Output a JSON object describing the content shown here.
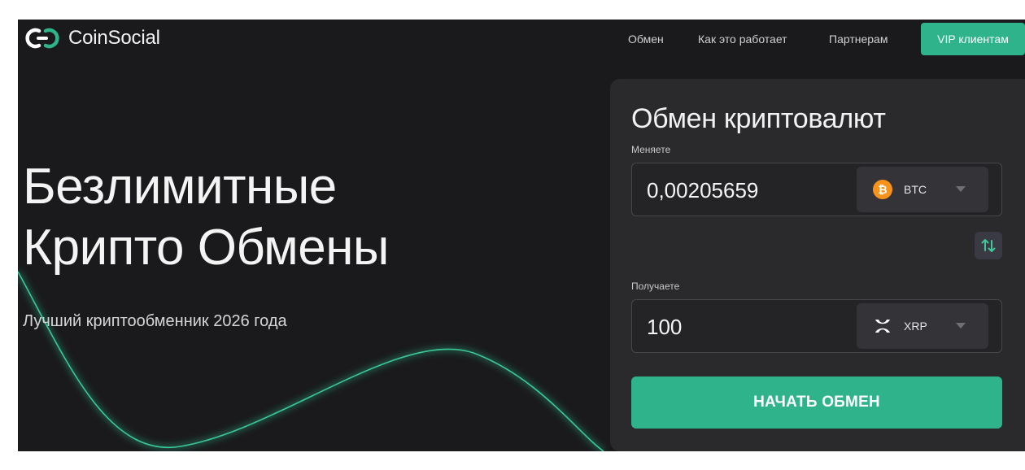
{
  "brand": {
    "name": "CoinSocial",
    "accent": "#2fb38a"
  },
  "nav": {
    "links": [
      "Обмен",
      "Как это работает",
      "Партнерам"
    ],
    "vip_label": "VIP клиентам"
  },
  "hero": {
    "title_line1": "Безлимитные",
    "title_line2": "Крипто Обмены",
    "subtitle": "Лучший криптообменник 2026 года"
  },
  "exchange": {
    "title": "Обмен криптовалют",
    "send": {
      "label": "Меняете",
      "amount": "0,00205659",
      "currency": "BTC",
      "icon": "bitcoin-icon"
    },
    "receive": {
      "label": "Получаете",
      "amount": "100",
      "currency": "XRP",
      "icon": "xrp-icon"
    },
    "swap_icon": "swap-arrows-icon",
    "submit_label": "НАЧАТЬ ОБМЕН"
  }
}
